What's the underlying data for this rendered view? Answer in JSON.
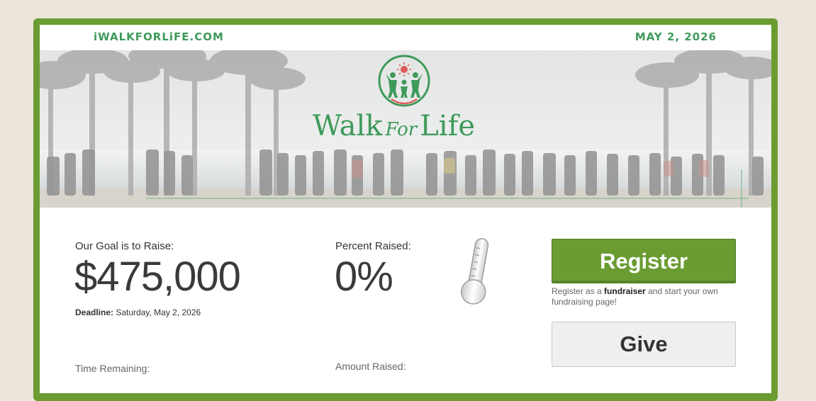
{
  "header": {
    "site": "iWALKFORLiFE.COM",
    "date": "MAY 2, 2026"
  },
  "banner": {
    "logo_word1": "Walk",
    "logo_word2": "For",
    "logo_word3": "Life"
  },
  "goal": {
    "label": "Our Goal is to Raise:",
    "amount": "$475,000",
    "deadline_label": "Deadline:",
    "deadline_value": "Saturday, May 2, 2026"
  },
  "percent": {
    "label": "Percent Raised:",
    "value": "0%",
    "fill_fraction": 0
  },
  "time_remaining": {
    "label": "Time Remaining:"
  },
  "amount_raised": {
    "label": "Amount Raised:"
  },
  "actions": {
    "register_label": "Register",
    "register_note_pre": "Register as a",
    "register_note_bold": "fundraiser",
    "register_note_post": "and start your own fundraising page!",
    "give_label": "Give"
  },
  "colors": {
    "brand_green": "#6a9c32",
    "logo_green": "#3f9a5a",
    "background": "#ece5dc"
  },
  "icons": [
    "walk-for-life-emblem",
    "thermometer-icon"
  ]
}
